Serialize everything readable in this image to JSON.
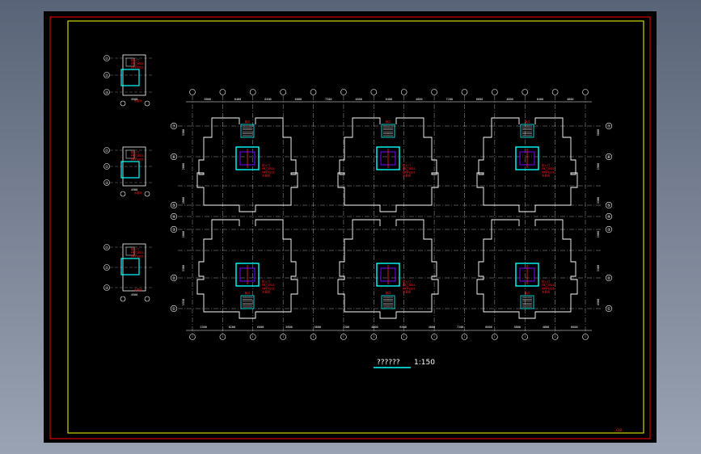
{
  "drawing": {
    "title": "??????",
    "scale": "1:150",
    "corner_text": "CAD"
  },
  "colors": {
    "background": "#000000",
    "outer_frame": "#ff0000",
    "inner_frame": "#ffff00",
    "walls": "#ffffff",
    "axis": "#cccccc",
    "stair": "#00ffff",
    "annotation": "#ff2020",
    "core": "#7a00ff"
  },
  "top_dimensions": [
    "6000",
    "6400",
    "6400",
    "6600",
    "7200",
    "4800",
    "6400",
    "4800",
    "7200",
    "6600",
    "4800",
    "6400",
    "4800"
  ],
  "bottom_dimensions": [
    "2300",
    "6200",
    "6000",
    "5800",
    "5800",
    "7200",
    "4800",
    "6400",
    "4800",
    "7200",
    "6000",
    "5800",
    "4800",
    "6600"
  ],
  "right_dimensions": [
    "5600",
    "1900",
    "3300",
    "1900",
    "3300",
    "4500"
  ],
  "left_dimensions": [
    "3300",
    "2000",
    "2800",
    "1800",
    "3300",
    "1950"
  ],
  "row_axis_labels": [
    "⑦",
    "⑥",
    "⑤",
    "④",
    "③",
    "②",
    "①"
  ],
  "detail_dimension": "4500",
  "annotation_lines": [
    "防火门",
    "FM乙0921",
    "FM甲1221",
    "水表间",
    "管井"
  ]
}
